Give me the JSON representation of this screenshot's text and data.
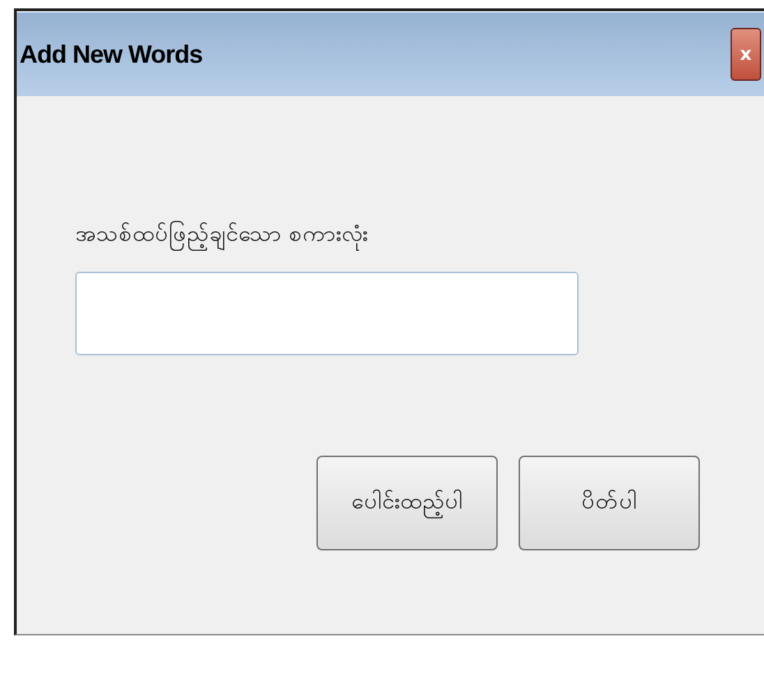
{
  "window": {
    "title": "Add New Words",
    "close_label": "x"
  },
  "field": {
    "label": "အသစ်ထပ်ဖြည့်ချင်သော စကားလုံး"
  },
  "buttons": [
    "ပေါင်းထည့်ပါ",
    "ပိတ်ပါ"
  ]
}
